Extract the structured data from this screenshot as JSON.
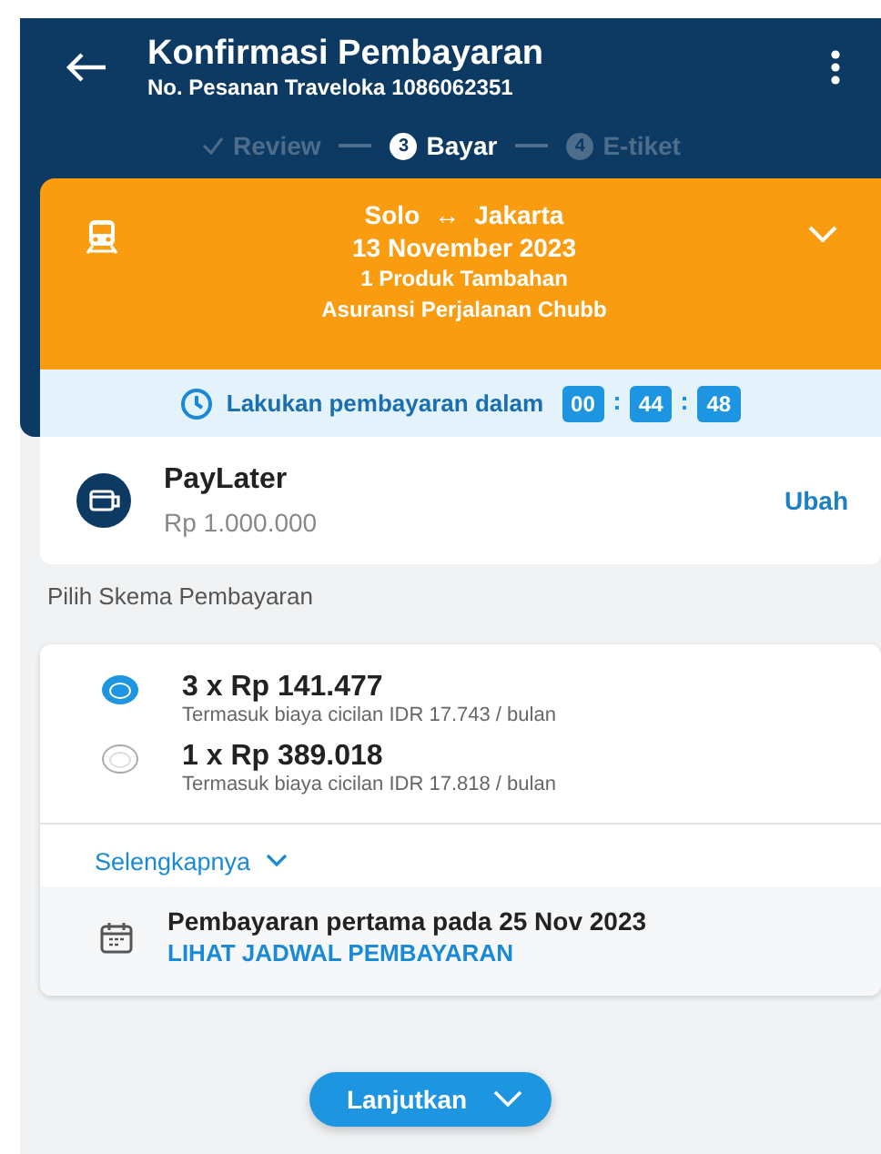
{
  "header": {
    "title": "Konfirmasi Pembayaran",
    "subtitle": "No. Pesanan Traveloka 1086062351"
  },
  "steps": [
    {
      "label": "Review",
      "done": true,
      "selected": false
    },
    {
      "label": "Bayar",
      "number": "3",
      "done": false,
      "selected": true
    },
    {
      "label": "E-tiket",
      "number": "4",
      "done": false,
      "selected": false
    }
  ],
  "trip": {
    "route_from": "Solo",
    "route_arrow": "↔",
    "route_to": "Jakarta",
    "date": "13 November 2023",
    "addon_count": "1 Produk Tambahan",
    "addon": "Asuransi Perjalanan Chubb",
    "expanded": false
  },
  "timer": {
    "label": "Lakukan pembayaran dalam",
    "parts": [
      "00",
      "44",
      "48"
    ]
  },
  "payment_method": {
    "name": "PayLater",
    "amount": "Rp 1.000.000",
    "action": "Ubah"
  },
  "scheme_heading": "Pilih Skema Pembayaran",
  "schemes": [
    {
      "title": "3 x Rp 141.477",
      "note": "Termasuk biaya cicilan IDR 17.743 / bulan",
      "selected": true
    },
    {
      "title": "1 x Rp 389.018",
      "note": "Termasuk biaya cicilan IDR 17.818 / bulan",
      "selected": false
    }
  ],
  "more_link": "Selengkapnya",
  "first_payment": {
    "text": "Pembayaran pertama pada 25 Nov 2023",
    "link": "LIHAT JADWAL PEMBAYARAN"
  },
  "continue_button": "Lanjutkan"
}
